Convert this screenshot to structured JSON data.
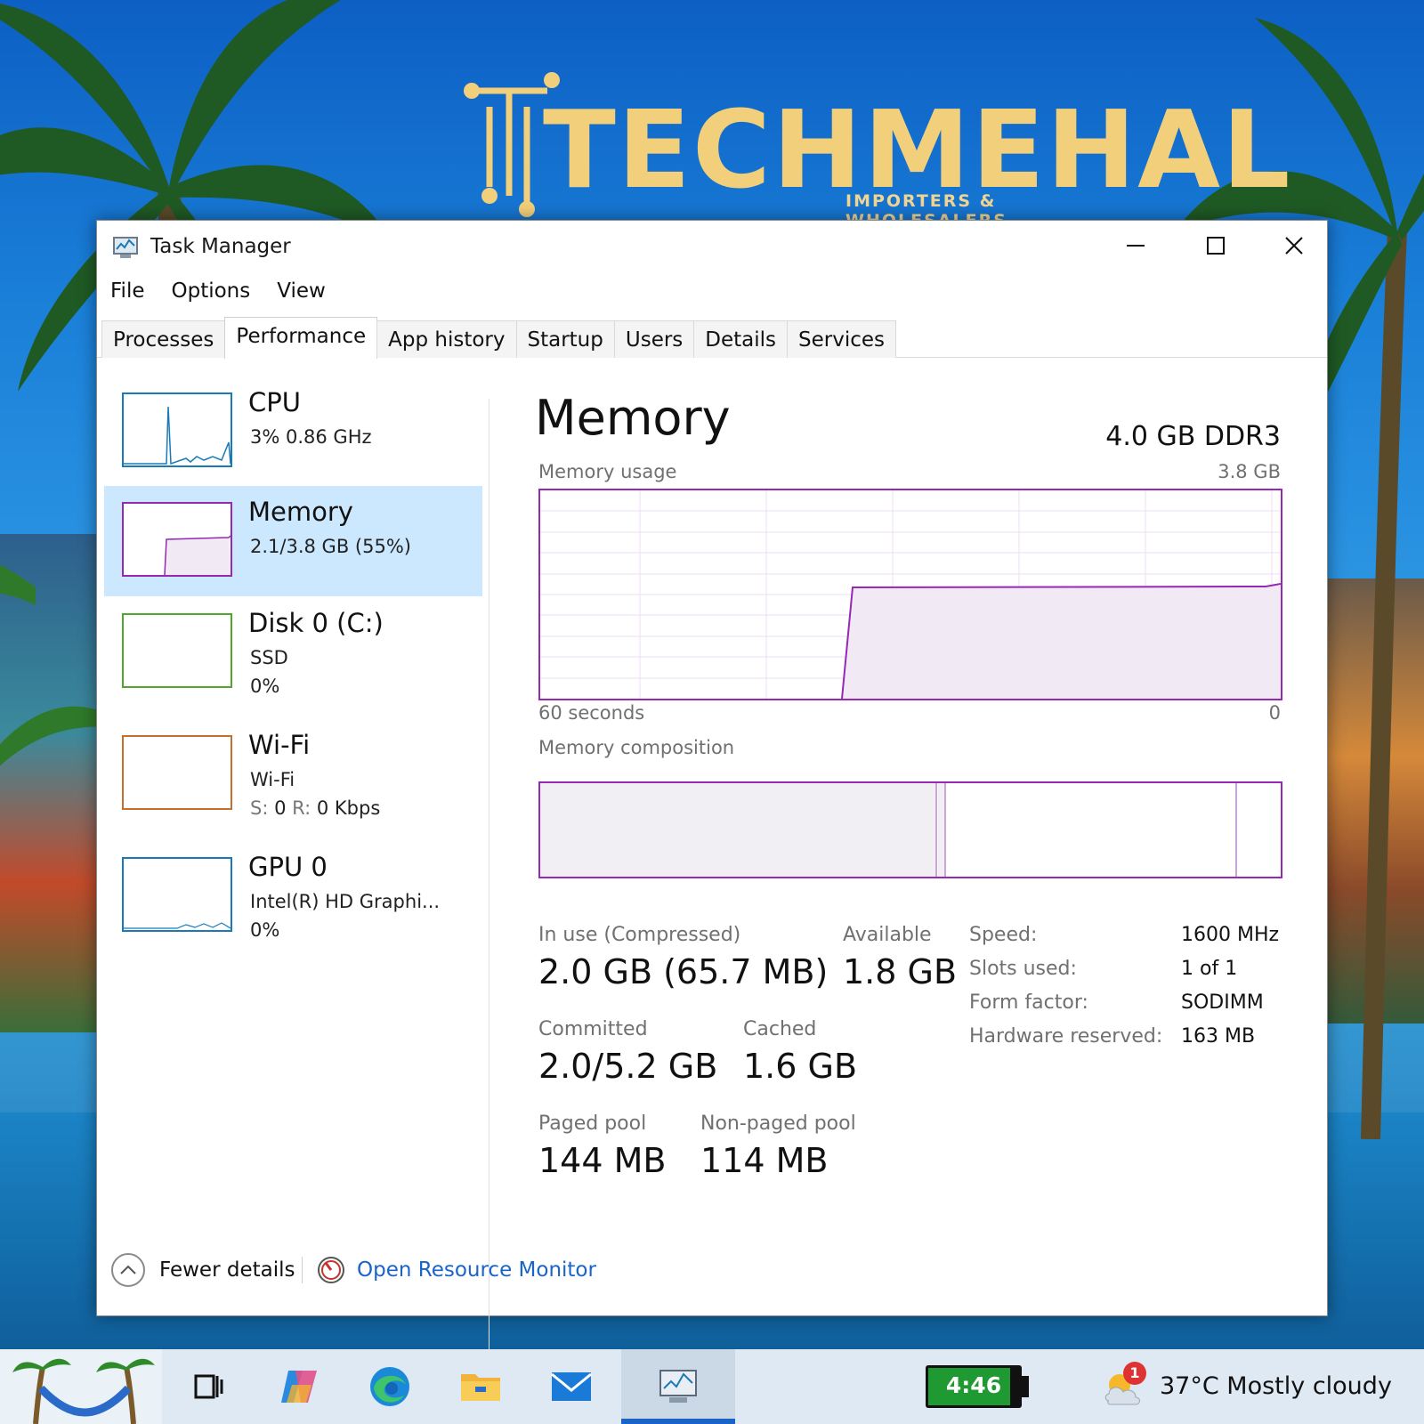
{
  "wallpaper": {
    "logo_text": "TECHMEHAL",
    "logo_tagline": "IMPORTERS & WHOLESALERS"
  },
  "window": {
    "title": "Task Manager",
    "minimize_glyph": "—",
    "maximize_glyph": "☐",
    "close_glyph": "✕"
  },
  "menu": [
    "File",
    "Options",
    "View"
  ],
  "tabs": [
    "Processes",
    "Performance",
    "App history",
    "Startup",
    "Users",
    "Details",
    "Services"
  ],
  "active_tab": "Performance",
  "sidebar": {
    "items": [
      {
        "title": "CPU",
        "line1": "3%  0.86 GHz",
        "line2": "",
        "color": "#1a7ab8"
      },
      {
        "title": "Memory",
        "line1": "2.1/3.8 GB (55%)",
        "line2": "",
        "color": "#9528b4"
      },
      {
        "title": "Disk 0 (C:)",
        "line1": "SSD",
        "line2": "0%",
        "color": "#4da82c"
      },
      {
        "title": "Wi-Fi",
        "line1": "Wi-Fi",
        "line2_s": "S:",
        "line2_sv": "0",
        "line2_r": "R:",
        "line2_rv": "0 Kbps",
        "color": "#c4702a"
      },
      {
        "title": "GPU 0",
        "line1": "Intel(R) HD Graphi...",
        "line2": "0%",
        "color": "#1a7ab8"
      }
    ],
    "selected": "Memory"
  },
  "detail": {
    "title": "Memory",
    "spec": "4.0 GB DDR3",
    "usage_label": "Memory usage",
    "usage_max": "3.8 GB",
    "time_left": "60 seconds",
    "time_right": "0",
    "composition_label": "Memory composition",
    "usage_fraction": 0.55,
    "stats": {
      "in_use_label": "In use (Compressed)",
      "in_use_value": "2.0 GB (65.7 MB)",
      "available_label": "Available",
      "available_value": "1.8 GB",
      "committed_label": "Committed",
      "committed_value": "2.0/5.2 GB",
      "cached_label": "Cached",
      "cached_value": "1.6 GB",
      "paged_label": "Paged pool",
      "paged_value": "144 MB",
      "nonpaged_label": "Non-paged pool",
      "nonpaged_value": "114 MB"
    },
    "hardware": [
      {
        "label": "Speed:",
        "value": "1600 MHz"
      },
      {
        "label": "Slots used:",
        "value": "1 of 1"
      },
      {
        "label": "Form factor:",
        "value": "SODIMM"
      },
      {
        "label": "Hardware reserved:",
        "value": "163 MB"
      }
    ]
  },
  "footer": {
    "fewer_details": "Fewer details",
    "open_resource_monitor": "Open Resource Monitor"
  },
  "taskbar": {
    "battery_time": "4:46",
    "weather_badge": "1",
    "weather": "37°C  Mostly cloudy"
  }
}
